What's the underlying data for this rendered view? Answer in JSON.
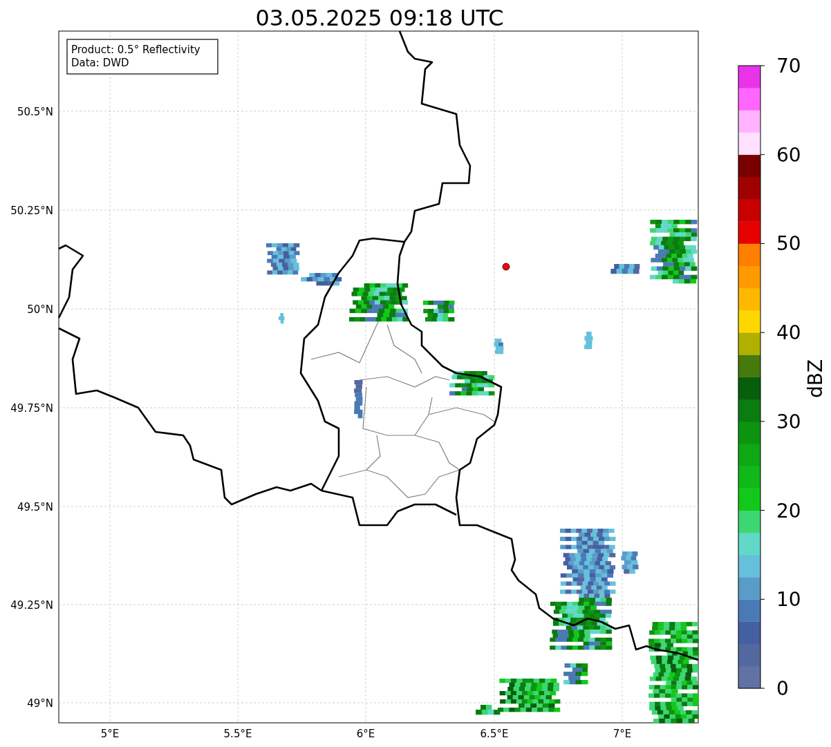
{
  "title": "03.05.2025 09:18 UTC",
  "legend": [
    "Product: 0.5° Reflectivity",
    "Data: DWD"
  ],
  "map": {
    "xticks": [
      "5°E",
      "5.5°E",
      "6°E",
      "6.5°E",
      "7°E"
    ],
    "yticks": [
      "50.5°N",
      "50.25°N",
      "50°N",
      "49.75°N",
      "49.5°N",
      "49.25°N",
      "49°N"
    ]
  },
  "colorbar": {
    "label": "dBZ",
    "ticks": [
      "70",
      "60",
      "50",
      "40",
      "30",
      "20",
      "10",
      "0"
    ],
    "segments": [
      {
        "color": "#6272a4"
      },
      {
        "color": "#5468a0"
      },
      {
        "color": "#4460a2"
      },
      {
        "color": "#4a7ab5"
      },
      {
        "color": "#5a9cc8"
      },
      {
        "color": "#66c0dc"
      },
      {
        "color": "#62d8c8"
      },
      {
        "color": "#3ed672"
      },
      {
        "color": "#12c81a"
      },
      {
        "color": "#10b818"
      },
      {
        "color": "#0ea814"
      },
      {
        "color": "#0c9410"
      },
      {
        "color": "#0a7c10"
      },
      {
        "color": "#075f0c"
      },
      {
        "color": "#477a0c"
      },
      {
        "color": "#b0b000"
      },
      {
        "color": "#ffd700"
      },
      {
        "color": "#ffb800"
      },
      {
        "color": "#ff9a00"
      },
      {
        "color": "#ff7f00"
      },
      {
        "color": "#e60000"
      },
      {
        "color": "#c80000"
      },
      {
        "color": "#a00000"
      },
      {
        "color": "#780000"
      },
      {
        "color": "#ffe0ff"
      },
      {
        "color": "#ffb3ff"
      },
      {
        "color": "#ff66ff"
      },
      {
        "color": "#e833e8"
      }
    ]
  }
}
